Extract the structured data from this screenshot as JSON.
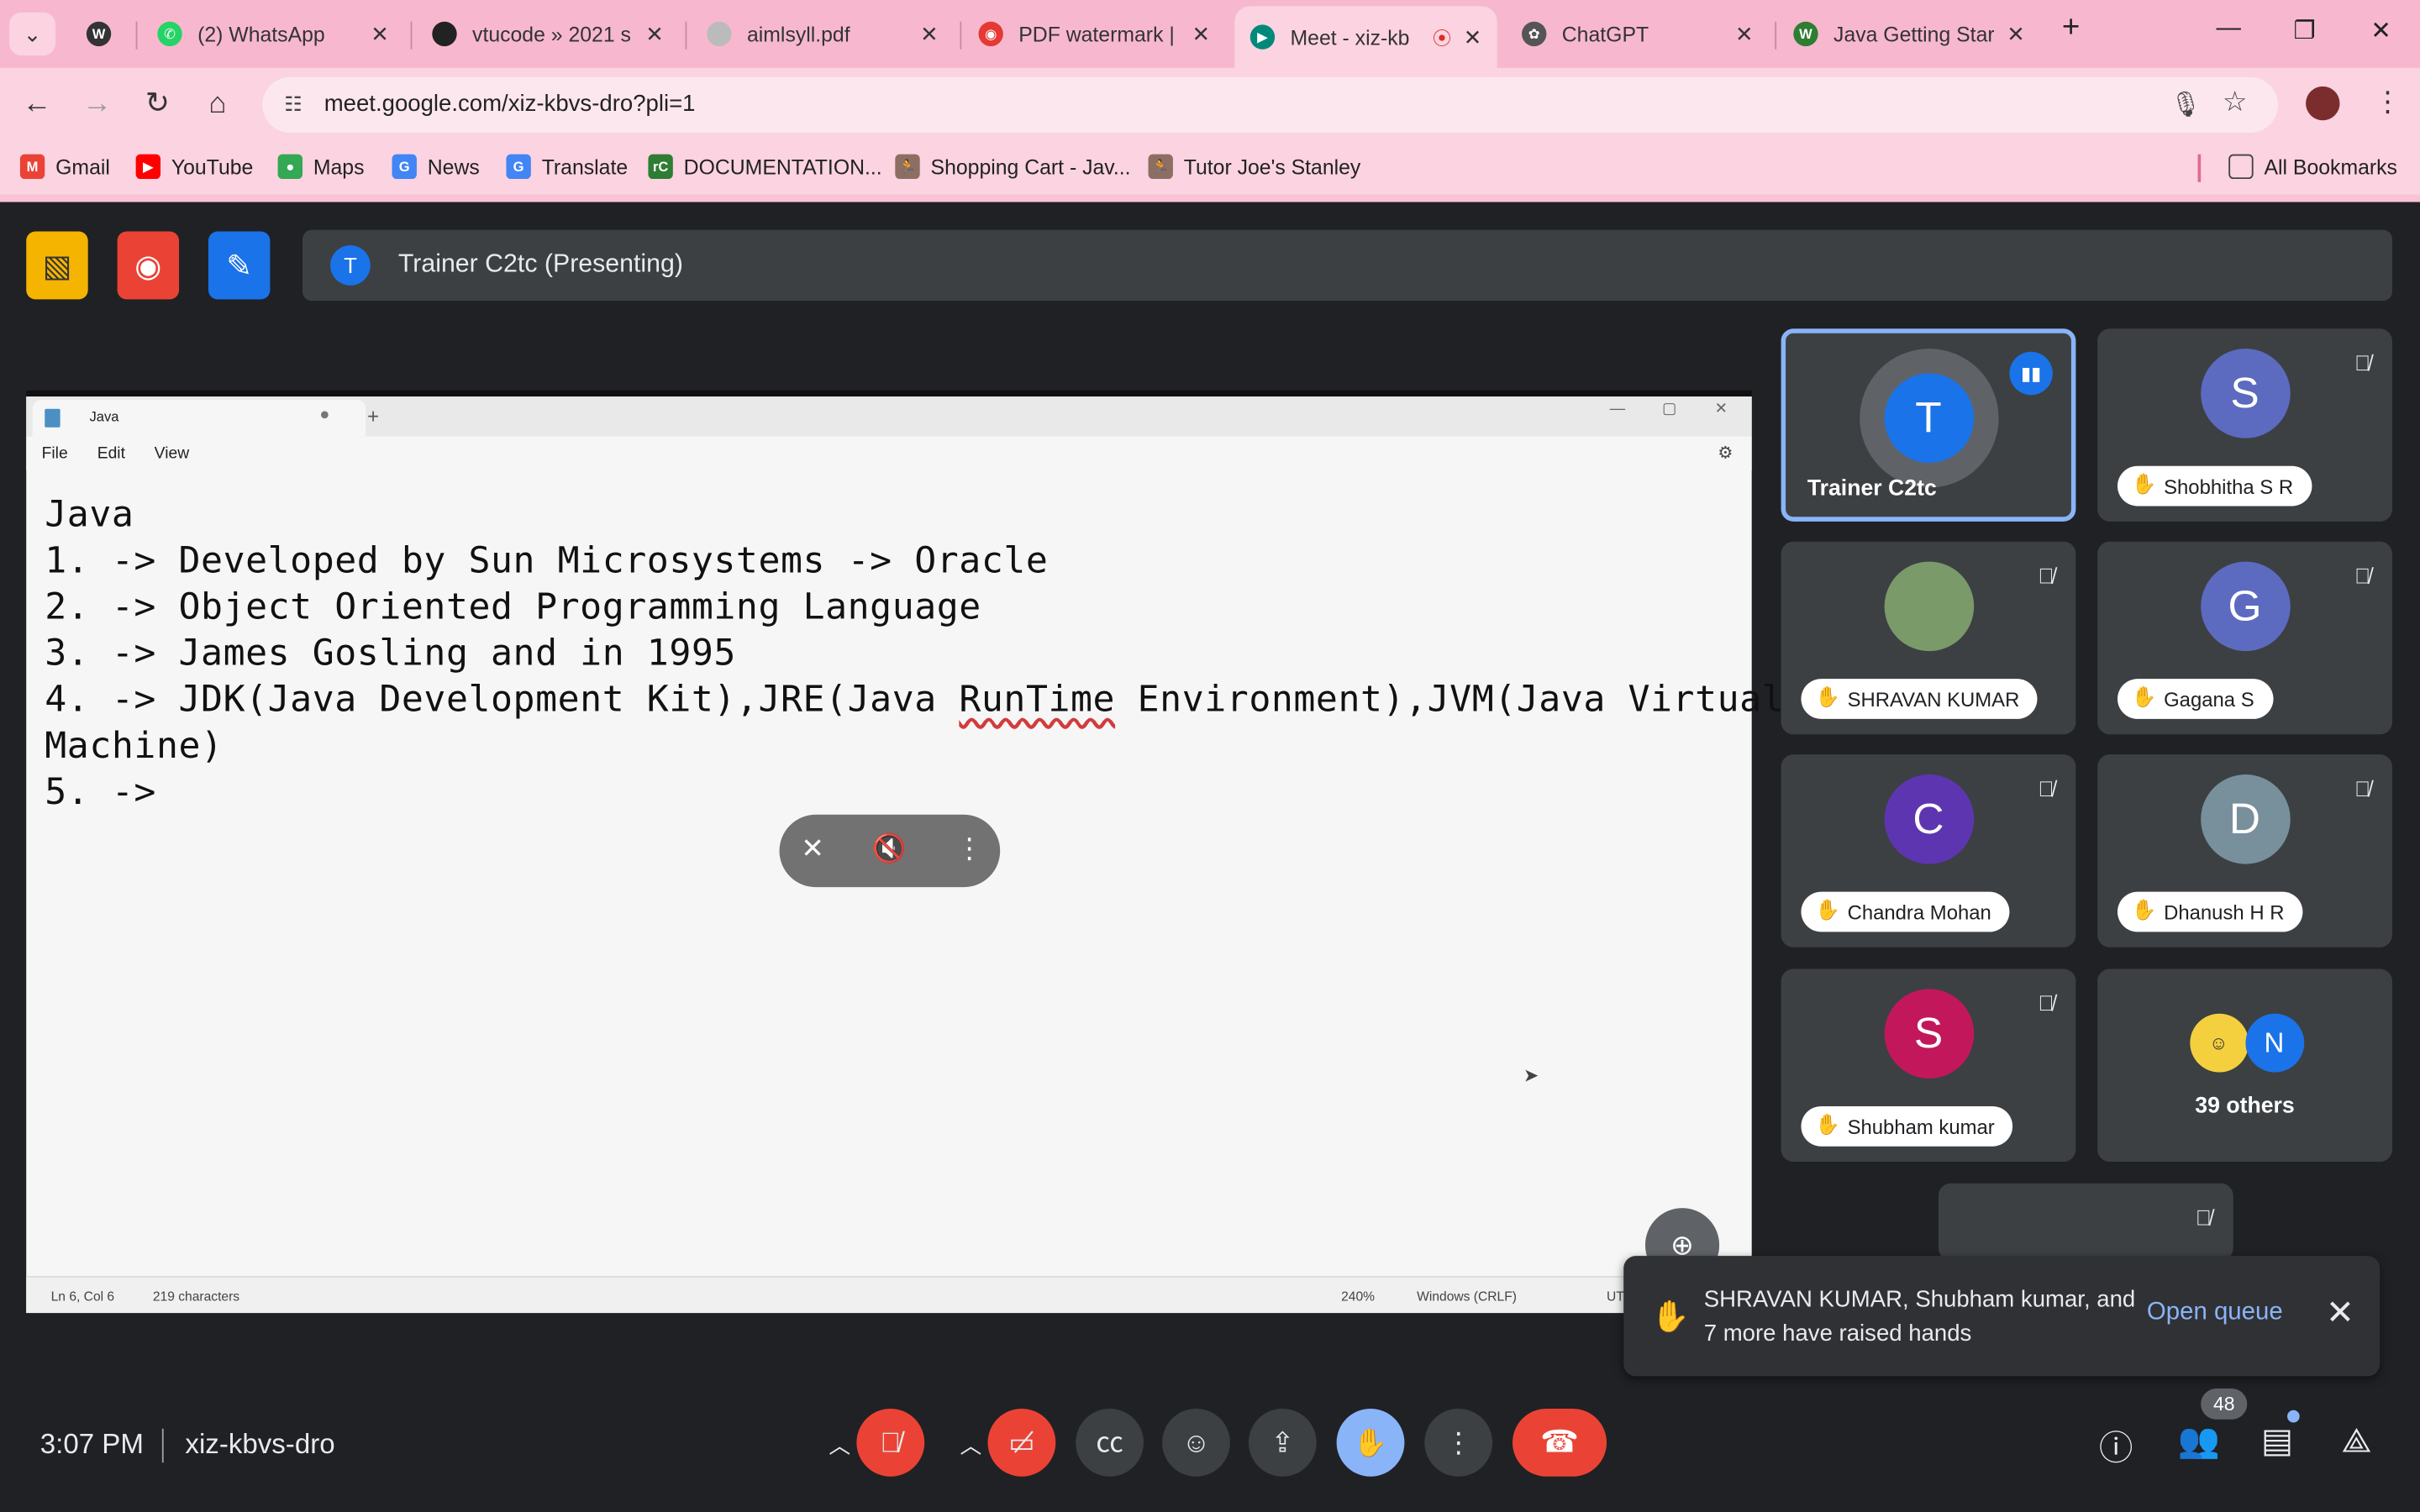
{
  "browser": {
    "tabs": [
      {
        "label": "",
        "favicon_color": "#333333",
        "favicon_letter": "",
        "active": false
      },
      {
        "label": "(2) WhatsApp",
        "favicon_color": "#25d366",
        "favicon_letter": "✆",
        "active": false
      },
      {
        "label": "vtucode » 2021 s",
        "favicon_color": "#222222",
        "favicon_letter": "",
        "active": false
      },
      {
        "label": "aimlsyll.pdf",
        "favicon_color": "#9aa0a6",
        "favicon_letter": "",
        "active": false
      },
      {
        "label": "PDF watermark |",
        "favicon_color": "#e53935",
        "favicon_letter": "◉",
        "active": false
      },
      {
        "label": "Meet - xiz-kb",
        "favicon_color": "#00897b",
        "favicon_letter": "▶",
        "active": true
      },
      {
        "label": "ChatGPT",
        "favicon_color": "#555555",
        "favicon_letter": "✿",
        "active": false
      },
      {
        "label": "Java Getting Star",
        "favicon_color": "#2e7d32",
        "favicon_letter": "W",
        "active": false
      }
    ],
    "url": "meet.google.com/xiz-kbvs-dro?pli=1",
    "bookmarks": [
      {
        "label": "Gmail",
        "color": "#ea4335"
      },
      {
        "label": "YouTube",
        "color": "#ff0000"
      },
      {
        "label": "Maps",
        "color": "#34a853"
      },
      {
        "label": "News",
        "color": "#4285f4"
      },
      {
        "label": "Translate",
        "color": "#4285f4"
      },
      {
        "label": "DOCUMENTATION...",
        "color": "#2e7d32"
      },
      {
        "label": "Shopping Cart - Jav...",
        "color": "#8d6e63"
      },
      {
        "label": "Tutor Joe's Stanley",
        "color": "#8d6e63"
      }
    ],
    "all_bookmarks": "All Bookmarks"
  },
  "meet": {
    "presenting_initial": "T",
    "presenting_label": "Trainer C2tc (Presenting)",
    "notepad": {
      "tab_label": "Java",
      "menu": [
        "File",
        "Edit",
        "View"
      ],
      "lines": [
        "Java",
        "1. -> Developed by Sun Microsystems -> Oracle",
        "2. -> Object Oriented Programming Language",
        "3. -> James Gosling and in 1995",
        "4. -> JDK(Java Development Kit),JRE(Java ",
        "Machine)",
        "5. ->"
      ],
      "line4_squiggle": "RunTime",
      "line4_rest": " Environment),JVM(Java Virtual",
      "status": {
        "position": "Ln 6, Col 6",
        "chars": "219 characters",
        "zoom": "240%",
        "eol": "Windows (CRLF)",
        "enc": "UT"
      }
    },
    "participants": [
      {
        "name": "Trainer C2tc",
        "initial": "T",
        "color": "#1a73e8",
        "speaking": true,
        "hand": false
      },
      {
        "name": "Shobhitha S R",
        "initial": "S",
        "color": "#5c6bc0",
        "speaking": false,
        "hand": true
      },
      {
        "name": "SHRAVAN KUMAR",
        "initial": "",
        "color": "#7a9a6a",
        "speaking": false,
        "hand": true
      },
      {
        "name": "Gagana S",
        "initial": "G",
        "color": "#5c6bc0",
        "speaking": false,
        "hand": true
      },
      {
        "name": "Chandra Mohan",
        "initial": "C",
        "color": "#5e35b1",
        "speaking": false,
        "hand": true
      },
      {
        "name": "Dhanush H R",
        "initial": "D",
        "color": "#78909c",
        "speaking": false,
        "hand": true
      },
      {
        "name": "Shubham kumar",
        "initial": "S",
        "color": "#c2185b",
        "speaking": false,
        "hand": true
      }
    ],
    "others": {
      "label": "39 others",
      "initial": "N",
      "color": "#1a73e8"
    },
    "raised_hands": {
      "text": "SHRAVAN KUMAR, Shubham kumar, and 7 more have raised hands",
      "action": "Open queue"
    },
    "time": "3:07 PM",
    "meeting_code": "xiz-kbvs-dro",
    "people_count": "48"
  }
}
